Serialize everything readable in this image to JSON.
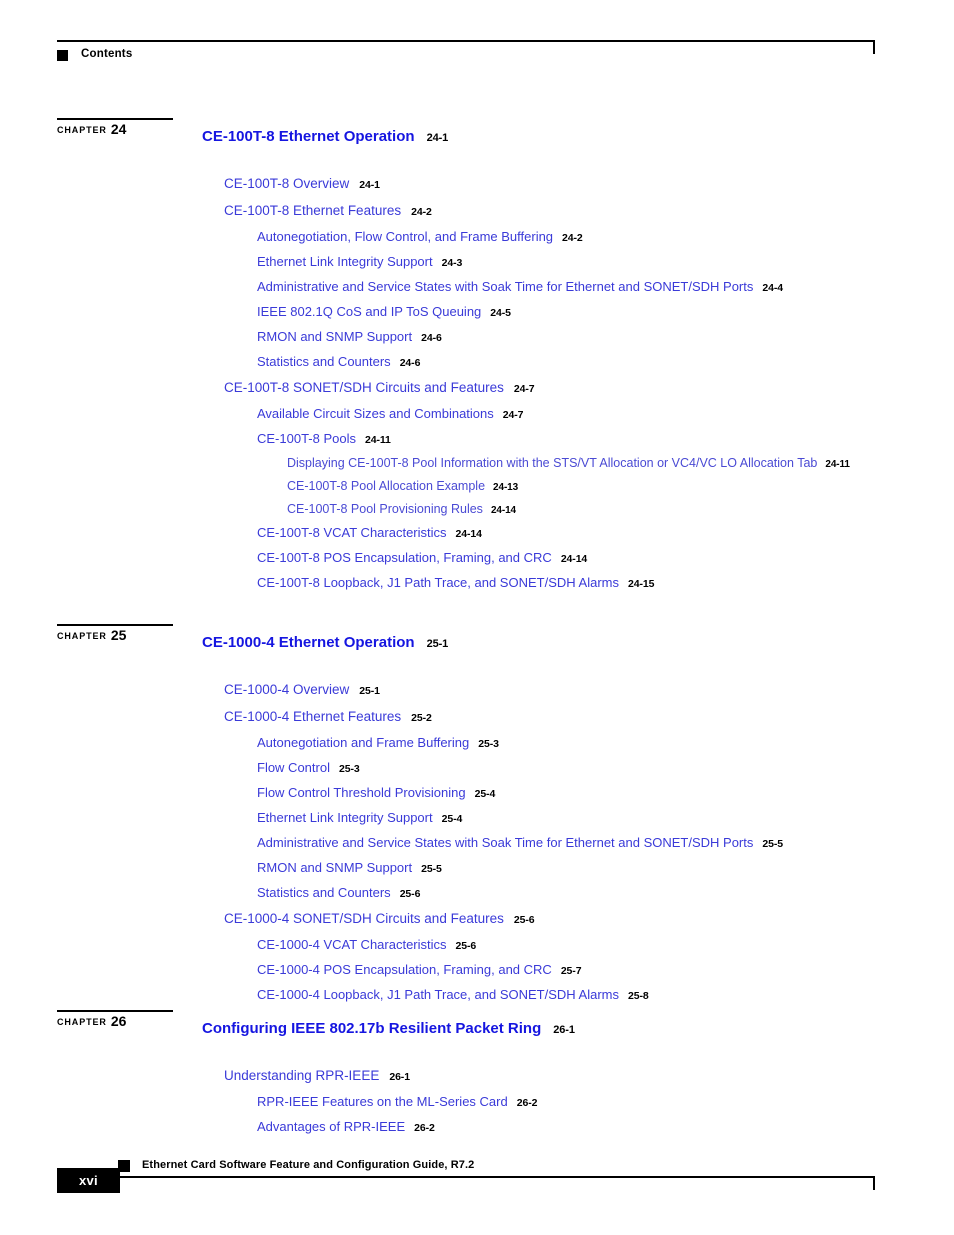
{
  "header": {
    "label": "Contents",
    "square_icon": "black-square-icon"
  },
  "footer": {
    "guide_title": "Ethernet Card Software Feature and Configuration Guide, R7.2",
    "page_number": "xvi",
    "square_icon": "black-square-icon"
  },
  "colors": {
    "chapter_title_blue": "#1515e0",
    "entry_blue": "#3a3ad8",
    "subentry_blue": "#4a4ad4",
    "rule_black": "#000000"
  },
  "toc": {
    "chapters": [
      {
        "marker_label": "CHAPTER",
        "marker_number": "24",
        "title": "CE-100T-8  Ethernet Operation",
        "page": "24-1",
        "entries": [
          {
            "level": 1,
            "title": "CE-100T-8 Overview",
            "page": "24-1"
          },
          {
            "level": 1,
            "title": "CE-100T-8 Ethernet Features",
            "page": "24-2"
          },
          {
            "level": 2,
            "title": "Autonegotiation, Flow Control, and Frame Buffering",
            "page": "24-2"
          },
          {
            "level": 2,
            "title": "Ethernet Link Integrity Support",
            "page": "24-3"
          },
          {
            "level": 2,
            "title": "Administrative and Service States with Soak Time for Ethernet and SONET/SDH Ports",
            "page": "24-4"
          },
          {
            "level": 2,
            "title": "IEEE 802.1Q CoS and IP ToS Queuing",
            "page": "24-5"
          },
          {
            "level": 2,
            "title": "RMON and SNMP Support",
            "page": "24-6"
          },
          {
            "level": 2,
            "title": "Statistics and Counters",
            "page": "24-6"
          },
          {
            "level": 1,
            "title": "CE-100T-8 SONET/SDH Circuits and Features",
            "page": "24-7"
          },
          {
            "level": 2,
            "title": "Available Circuit Sizes and Combinations",
            "page": "24-7"
          },
          {
            "level": 2,
            "title": "CE-100T-8 Pools",
            "page": "24-11"
          },
          {
            "level": 3,
            "title": "Displaying CE-100T-8 Pool Information with the STS/VT Allocation or VC4/VC LO Allocation Tab",
            "page": "24-11"
          },
          {
            "level": 3,
            "title": "CE-100T-8 Pool Allocation Example",
            "page": "24-13"
          },
          {
            "level": 3,
            "title": "CE-100T-8 Pool Provisioning Rules",
            "page": "24-14"
          },
          {
            "level": 2,
            "title": "CE-100T-8 VCAT Characteristics",
            "page": "24-14"
          },
          {
            "level": 2,
            "title": "CE-100T-8 POS Encapsulation, Framing, and CRC",
            "page": "24-14"
          },
          {
            "level": 2,
            "title": "CE-100T-8 Loopback, J1 Path Trace, and SONET/SDH Alarms",
            "page": "24-15"
          }
        ]
      },
      {
        "marker_label": "CHAPTER",
        "marker_number": "25",
        "title": "CE-1000-4  Ethernet Operation",
        "page": "25-1",
        "entries": [
          {
            "level": 1,
            "title": "CE-1000-4 Overview",
            "page": "25-1"
          },
          {
            "level": 1,
            "title": "CE-1000-4 Ethernet Features",
            "page": "25-2"
          },
          {
            "level": 2,
            "title": "Autonegotiation and Frame Buffering",
            "page": "25-3"
          },
          {
            "level": 2,
            "title": "Flow Control",
            "page": "25-3"
          },
          {
            "level": 2,
            "title": "Flow Control Threshold Provisioning",
            "page": "25-4"
          },
          {
            "level": 2,
            "title": "Ethernet Link Integrity Support",
            "page": "25-4"
          },
          {
            "level": 2,
            "title": "Administrative and Service States with Soak Time for Ethernet and SONET/SDH Ports",
            "page": "25-5"
          },
          {
            "level": 2,
            "title": "RMON and SNMP Support",
            "page": "25-5"
          },
          {
            "level": 2,
            "title": "Statistics and Counters",
            "page": "25-6"
          },
          {
            "level": 1,
            "title": "CE-1000-4 SONET/SDH Circuits and Features",
            "page": "25-6"
          },
          {
            "level": 2,
            "title": "CE-1000-4 VCAT Characteristics",
            "page": "25-6"
          },
          {
            "level": 2,
            "title": "CE-1000-4 POS Encapsulation, Framing, and CRC",
            "page": "25-7"
          },
          {
            "level": 2,
            "title": "CE-1000-4 Loopback, J1 Path Trace, and SONET/SDH Alarms",
            "page": "25-8"
          }
        ]
      },
      {
        "marker_label": "CHAPTER",
        "marker_number": "26",
        "title": "Configuring IEEE 802.17b Resilient Packet Ring",
        "page": "26-1",
        "entries": [
          {
            "level": 1,
            "title": "Understanding RPR-IEEE",
            "page": "26-1"
          },
          {
            "level": 2,
            "title": "RPR-IEEE Features on the ML-Series Card",
            "page": "26-2"
          },
          {
            "level": 2,
            "title": "Advantages of RPR-IEEE",
            "page": "26-2"
          }
        ]
      }
    ]
  }
}
